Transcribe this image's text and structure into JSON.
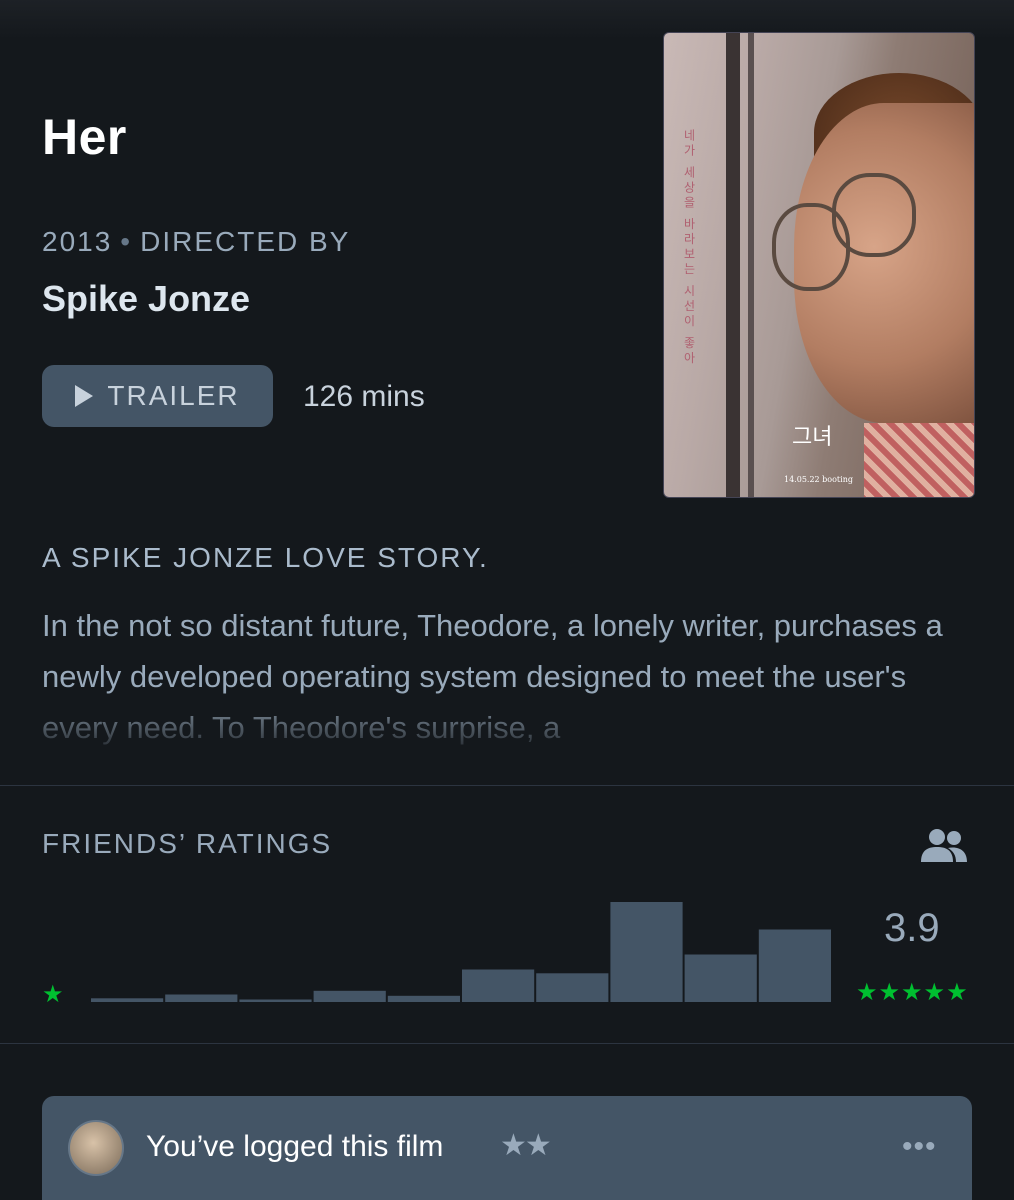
{
  "film": {
    "title": "Her",
    "year": "2013",
    "directed_by_label": "DIRECTED BY",
    "director": "Spike Jonze",
    "trailer_label": "TRAILER",
    "runtime": "126 mins",
    "tagline": "A SPIKE JONZE LOVE STORY.",
    "synopsis": "In the not so distant future, Theodore, a lonely writer, purchases a newly developed operating system designed to meet the user's every need. To Theodore's surprise, a"
  },
  "poster": {
    "korean_title": "그녀",
    "vertical_text": "네가 세상을 바라보는 시선이 좋아",
    "date_text": "14.05.22 booting"
  },
  "ratings": {
    "header": "FRIENDS’ RATINGS",
    "average": "3.9",
    "low_star": "★",
    "high_stars": "★★★★★",
    "icon": "friends-icon"
  },
  "chart_data": {
    "type": "bar",
    "title": "",
    "categories": [
      "0.5",
      "1",
      "1.5",
      "2",
      "2.5",
      "3",
      "3.5",
      "4",
      "4.5",
      "5"
    ],
    "values": [
      3,
      6,
      2,
      9,
      5,
      26,
      23,
      80,
      38,
      58
    ],
    "ylim": [
      0,
      80
    ],
    "bar_color": "#445566",
    "grid": false
  },
  "log": {
    "text": "You’ve logged this film",
    "stars": "★★",
    "more": "•••"
  },
  "colors": {
    "background": "#14181c",
    "accent_green": "#00c030",
    "slate": "#445566",
    "muted_text": "#99aabb"
  }
}
